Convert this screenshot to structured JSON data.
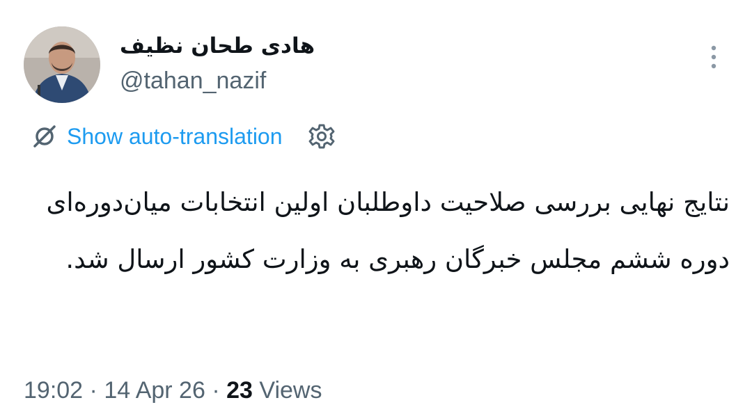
{
  "author": {
    "display_name": "هادی طحان نظیف",
    "handle": "@tahan_nazif"
  },
  "translation": {
    "label": "Show auto-translation"
  },
  "tweet": {
    "text": "نتایج نهایی بررسی صلاحیت داوطلبان اولین انتخابات میان‌دوره‌ای دوره ششم مجلس خبرگان رهبری به وزارت کشور ارسال شد."
  },
  "meta": {
    "time": "19:02",
    "separator": " · ",
    "date": "14 Apr 26",
    "views_count": "23",
    "views_label": "Views"
  },
  "icons": {
    "translate": "translate-off-icon",
    "settings": "gear-icon",
    "more": "more-vertical-icon"
  },
  "colors": {
    "link": "#1d9bf0",
    "secondary": "#536471",
    "primary": "#0f1419"
  }
}
